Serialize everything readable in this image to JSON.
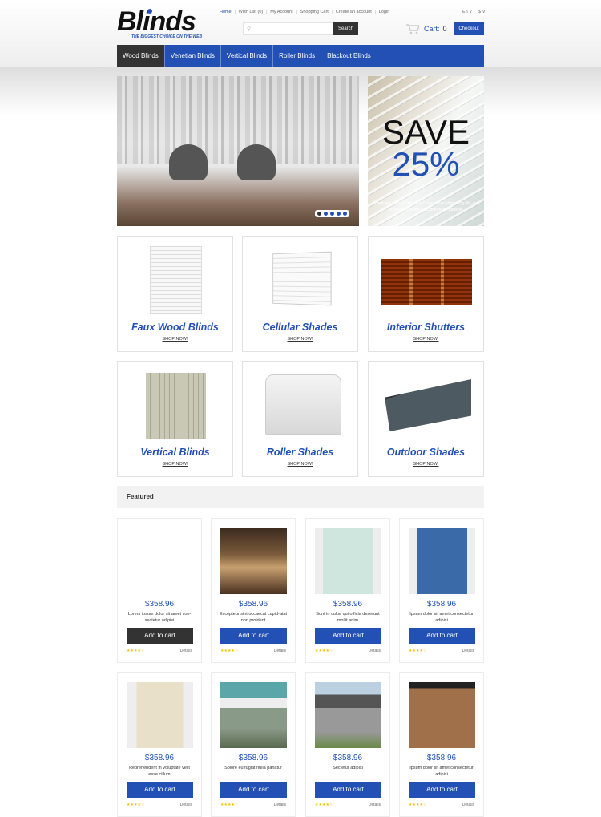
{
  "brand": {
    "name": "Blinds",
    "tagline": "THE BIGGEST CHOICE ON THE WEB",
    "accent": "#2350b5"
  },
  "top_links": [
    "Home",
    "Wish List (0)",
    "My Account",
    "Shopping Cart",
    "Create an account",
    "Login"
  ],
  "language": "En ∨",
  "currency": "$ ∨",
  "search": {
    "placeholder": "",
    "button": "Search"
  },
  "cart": {
    "label": "Cart:",
    "count": "0",
    "checkout": "Checkout"
  },
  "nav": [
    "Wood Blinds",
    "Venetian Blinds",
    "Vertical Blinds",
    "Roller Blinds",
    "Blackout Blinds"
  ],
  "promo": {
    "save": "SAVE",
    "percent": "25%",
    "text": "Lorem ipsum dolor sit amet conse ctetur adipisicing elit, sed do eiusmod tempor incididunt ut labore et."
  },
  "categories": [
    {
      "title": "Faux Wood Blinds",
      "link": "SHOP NOW!"
    },
    {
      "title": "Cellular Shades",
      "link": "SHOP NOW!"
    },
    {
      "title": "Interior Shutters",
      "link": "SHOP NOW!"
    },
    {
      "title": "Vertical Blinds",
      "link": "SHOP NOW!"
    },
    {
      "title": "Roller Shades",
      "link": "SHOP NOW!"
    },
    {
      "title": "Outdoor Shades",
      "link": "SHOP NOW!"
    }
  ],
  "featured": {
    "title": "Featured",
    "add_label": "Add to cart",
    "details_label": "Details",
    "stars": "★★★★☆",
    "products": [
      {
        "price": "$358.96",
        "desc": "Lorem ipsum dolor sit amet con-sectetur adipisi",
        "rating": 4
      },
      {
        "price": "$358.96",
        "desc": "Excepteur sint occaecat cupid-atat non proident",
        "rating": 4
      },
      {
        "price": "$358.96",
        "desc": "Sunt in culpa qui officia deserunt mollit anim",
        "rating": 4
      },
      {
        "price": "$358.96",
        "desc": "Ipsum dolor sit amet consectetur adipisi",
        "rating": 4
      },
      {
        "price": "$358.96",
        "desc": "Reprehenderit in voluptate velit esse cillum",
        "rating": 4
      },
      {
        "price": "$358.96",
        "desc": "Solore eu fugiat nulla pariatur",
        "rating": 4
      },
      {
        "price": "$358.96",
        "desc": "Sectetur adipisi",
        "rating": 4
      },
      {
        "price": "$358.96",
        "desc": "Ipsum dolor sit amet consectetur adipisi",
        "rating": 4
      }
    ]
  }
}
